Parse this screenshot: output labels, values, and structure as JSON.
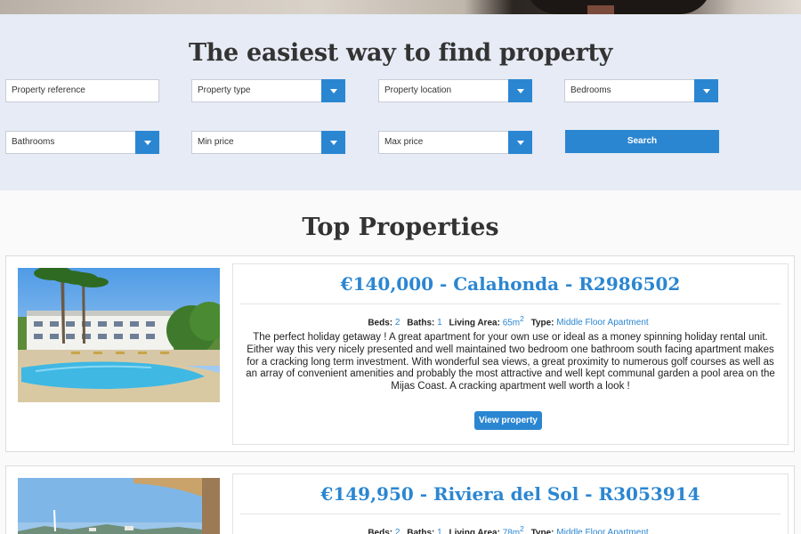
{
  "search": {
    "title": "The easiest way to find property",
    "fields": {
      "reference": "Property reference",
      "type": "Property type",
      "location": "Property location",
      "bedrooms": "Bedrooms",
      "bathrooms": "Bathrooms",
      "min_price": "Min price",
      "max_price": "Max price"
    },
    "search_button": "Search"
  },
  "top_properties": {
    "title": "Top Properties",
    "labels": {
      "beds": "Beds:",
      "baths": "Baths:",
      "living_area": "Living Area:",
      "type": "Type:",
      "view_button": "View property"
    },
    "items": [
      {
        "title": "€140,000 - Calahonda - R2986502",
        "beds": "2",
        "baths": "1",
        "area": "65m",
        "area_sup": "2",
        "type": "Middle Floor Apartment",
        "description": "The perfect holiday getaway ! A great apartment for your own use or ideal as a money spinning holiday rental unit. Either way this very nicely presented and well maintained two bedroom one bathroom south facing apartment makes for a cracking long term investment. With wonderful sea views, a great proximity to numerous golf courses as well as an array of convenient amenities and probably the most attractive and well kept communal garden a pool area on the Mijas Coast. A cracking apartment well worth a look !"
      },
      {
        "title": "€149,950 - Riviera del Sol - R3053914",
        "beds": "2",
        "baths": "1",
        "area": "78m",
        "area_sup": "2",
        "type": "Middle Floor Apartment"
      }
    ]
  },
  "colors": {
    "accent": "#2b86d1",
    "search_bg": "#e6ebf5"
  }
}
